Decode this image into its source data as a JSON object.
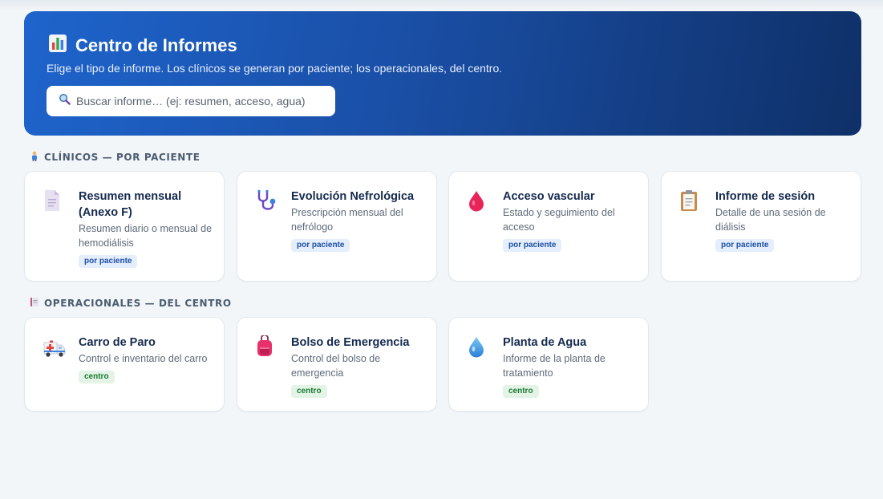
{
  "header": {
    "title": "Centro de Informes",
    "subtitle": "Elige el tipo de informe. Los clínicos se generan por paciente; los operacionales, del centro.",
    "search_placeholder": "Buscar informe… (ej: resumen, acceso, agua)",
    "search_value": ""
  },
  "sections": {
    "clinical": {
      "label": "CLÍNICOS — POR PACIENTE",
      "icon": "person-icon",
      "cards": [
        {
          "title": "Resumen mensual (Anexo F)",
          "desc": "Resumen diario o mensual de hemodiálisis",
          "badge": "por paciente",
          "icon": "document-icon"
        },
        {
          "title": "Evolución Nefrológica",
          "desc": "Prescripción mensual del nefrólogo",
          "badge": "por paciente",
          "icon": "stethoscope-icon"
        },
        {
          "title": "Acceso vascular",
          "desc": "Estado y seguimiento del acceso",
          "badge": "por paciente",
          "icon": "blood-drop-icon"
        },
        {
          "title": "Informe de sesión",
          "desc": "Detalle de una sesión de diálisis",
          "badge": "por paciente",
          "icon": "clipboard-icon"
        }
      ]
    },
    "operational": {
      "label": "OPERACIONALES — DEL CENTRO",
      "icon": "ledger-icon",
      "cards": [
        {
          "title": "Carro de Paro",
          "desc": "Control e inventario del carro",
          "badge": "centro",
          "icon": "ambulance-icon"
        },
        {
          "title": "Bolso de Emergencia",
          "desc": "Control del bolso de emergencia",
          "badge": "centro",
          "icon": "backpack-icon"
        },
        {
          "title": "Planta de Agua",
          "desc": "Informe de la planta de tratamiento",
          "badge": "centro",
          "icon": "water-drop-icon"
        }
      ]
    }
  },
  "colors": {
    "hero_gradient_start": "#1e64cc",
    "hero_gradient_end": "#0f3068",
    "patient_badge": "#1e4fa6",
    "center_badge": "#1d7a33"
  }
}
